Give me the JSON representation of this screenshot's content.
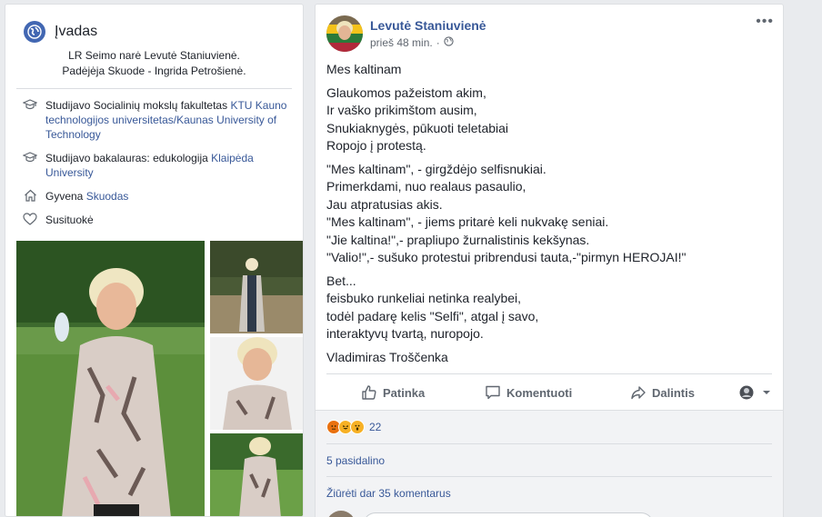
{
  "intro": {
    "title": "Įvadas",
    "bio_line1": "LR Seimo narė Levutė Staniuvienė.",
    "bio_line2": "Padėjėja Skuode - Ingrida Petrošienė."
  },
  "info": [
    {
      "prefix": "Studijavo Socialinių mokslų fakultetas ",
      "link": "KTU Kauno technologijos universitetas/Kaunas University of Technology"
    },
    {
      "prefix": "Studijavo bakalauras: edukologija ",
      "link": "Klaipėda University"
    },
    {
      "prefix": "Gyvena ",
      "link": "Skuodas"
    },
    {
      "prefix": "Susituokė",
      "link": ""
    }
  ],
  "post": {
    "author": "Levutė Staniuvienė",
    "time": "prieš 48 min.",
    "more": "•••",
    "title": "Mes kaltinam",
    "stanza1": [
      "Glaukomos pažeistom akim,",
      "Ir vaško prikimštom ausim,",
      "Snukiaknygės, pūkuoti teletabiai",
      "Ropojo į protestą."
    ],
    "stanza2": [
      "\"Mes kaltinam\", - girgždėjo selfisnukiai.",
      "Primerkdami, nuo realaus pasaulio,",
      "Jau atpratusias akis.",
      "\"Mes kaltinam\", - jiems pritarė keli nukvakę seniai.",
      "\"Jie kaltina!\",- prapliupo žurnalistinis kekšynas.",
      "\"Valio!\",- sušuko protestui pribrendusi tauta,-\"pirmyn HEROJAI!\""
    ],
    "stanza3": [
      "Bet...",
      "feisbuko runkeliai netinka realybei,",
      "todėl padarę kelis \"Selfi\", atgal į savo,",
      "interaktyvų tvartą, nuropojo."
    ],
    "signature": "Vladimiras Troščenka"
  },
  "actions": {
    "like": "Patinka",
    "comment": "Komentuoti",
    "share": "Dalintis"
  },
  "engagement": {
    "reaction_count": "22",
    "shares": "5 pasidalino",
    "view_comments": "Žiūrėti dar 35 komentarus"
  },
  "icons": {
    "globe": "globe-icon",
    "education": "graduation-cap-icon",
    "home": "home-icon",
    "heart": "heart-icon",
    "like": "thumbs-up-icon",
    "comment": "speech-bubble-icon",
    "share": "share-arrow-icon"
  },
  "colors": {
    "link": "#385898",
    "brand": "#4267b2",
    "secondary_text": "#606770"
  }
}
